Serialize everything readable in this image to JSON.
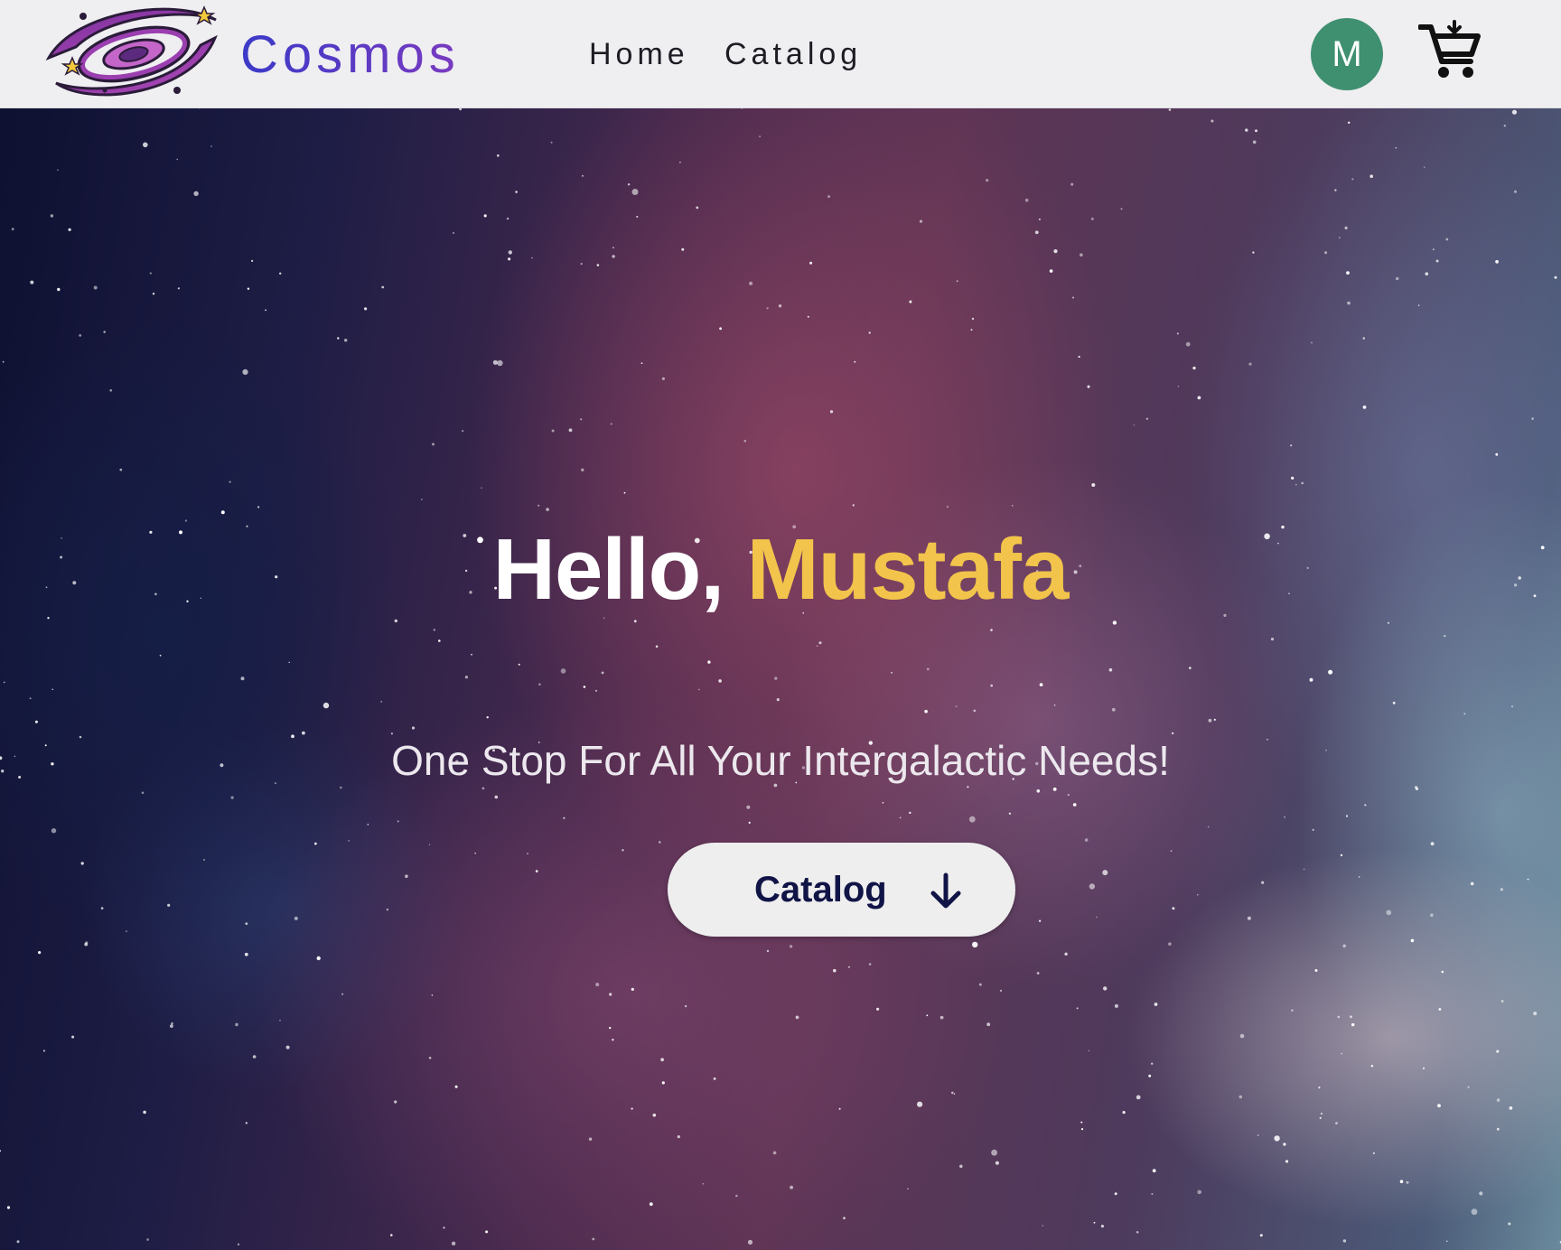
{
  "navbar": {
    "brand": "Cosmos",
    "links": [
      {
        "label": "Home"
      },
      {
        "label": "Catalog"
      }
    ],
    "avatar_initial": "M",
    "logo_icon": "galaxy-logo",
    "cart_icon": "add-to-cart-icon"
  },
  "hero": {
    "greeting_prefix": "Hello,",
    "user_name": "Mustafa",
    "tagline": "One Stop For All Your Intergalactic Needs!",
    "cta_label": "Catalog",
    "cta_icon": "arrow-down-icon"
  },
  "colors": {
    "navbar_bg": "#efeef1",
    "brand_gradient_start": "#3b3ac8",
    "brand_gradient_end": "#7a3ac0",
    "avatar_bg": "#3f9070",
    "name_accent": "#f2c44b",
    "cta_bg": "#eeeeee",
    "cta_text": "#111446"
  }
}
